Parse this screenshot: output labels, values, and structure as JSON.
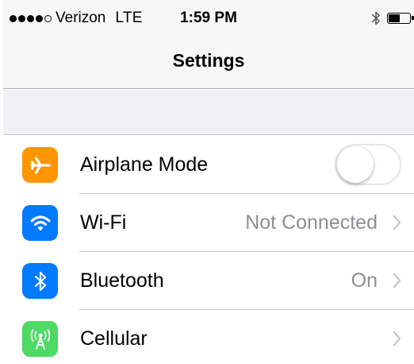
{
  "status_bar": {
    "signal_bars": 5,
    "signal_filled": 4,
    "carrier": "Verizon",
    "network": "LTE",
    "time": "1:59 PM",
    "bluetooth_icon": "bluetooth-icon",
    "battery_level": 0.6
  },
  "nav": {
    "title": "Settings"
  },
  "settings": [
    {
      "label": "Airplane Mode",
      "icon": "airplane-icon",
      "icon_color": "#ff9500",
      "control": "toggle",
      "toggle_on": false
    },
    {
      "label": "Wi-Fi",
      "icon": "wifi-icon",
      "icon_color": "#007aff",
      "value": "Not Connected",
      "control": "chevron"
    },
    {
      "label": "Bluetooth",
      "icon": "bluetooth-icon",
      "icon_color": "#007aff",
      "value": "On",
      "control": "chevron"
    },
    {
      "label": "Cellular",
      "icon": "cellular-icon",
      "icon_color": "#4cd964",
      "value": "",
      "control": "chevron"
    }
  ],
  "colors": {
    "chevron": "#c7c7cc",
    "secondary_text": "#8e8e93",
    "separator": "#c8c7cc",
    "grouped_background": "#efeff4"
  }
}
